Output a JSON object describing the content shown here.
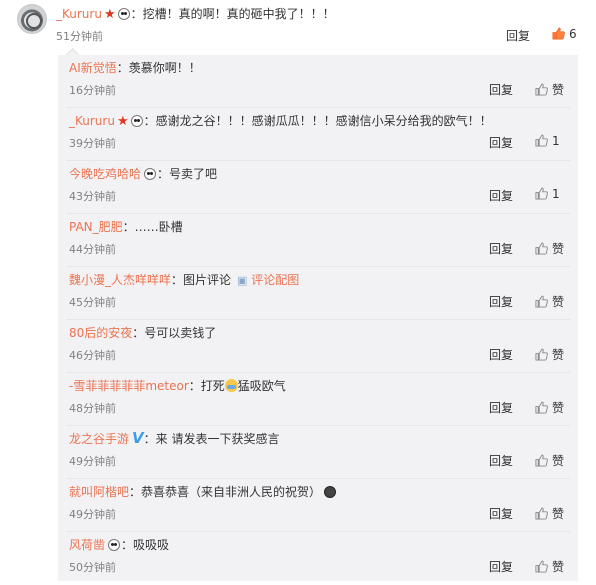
{
  "main_comment": {
    "username": "_Kururu",
    "text": "：挖槽！真的啊！真的砸中我了！！！",
    "time": "51分钟前",
    "reply_label": "回复",
    "like_count": "6"
  },
  "replies": [
    {
      "username": "AI新觉悟",
      "text": "：羡慕你啊！！",
      "time": "16分钟前",
      "reply_label": "回复",
      "like": "赞"
    },
    {
      "username": "_Kururu",
      "text": "：感谢龙之谷！！！感谢瓜瓜！！！感谢信小呆分给我的欧气！！",
      "time": "39分钟前",
      "reply_label": "回复",
      "like": "1"
    },
    {
      "username": "今晚吃鸡哈哈",
      "text": "：号卖了吧",
      "time": "43分钟前",
      "reply_label": "回复",
      "like": "1"
    },
    {
      "username": "PAN_肥肥",
      "text": "：……卧槽",
      "time": "44分钟前",
      "reply_label": "回复",
      "like": "赞"
    },
    {
      "username": "魏小漫_人杰咩咩咩",
      "text": "：图片评论",
      "link": "评论配图",
      "time": "45分钟前",
      "reply_label": "回复",
      "like": "赞"
    },
    {
      "username": "80后的安夜",
      "text": "：号可以卖钱了",
      "time": "46分钟前",
      "reply_label": "回复",
      "like": "赞"
    },
    {
      "username": "-雪菲菲菲菲菲meteor",
      "text_a": "：打死",
      "text_b": "猛吸欧气",
      "time": "48分钟前",
      "reply_label": "回复",
      "like": "赞"
    },
    {
      "username": "龙之谷手游",
      "text": "：来 请发表一下获奖感言",
      "time": "49分钟前",
      "reply_label": "回复",
      "like": "赞"
    },
    {
      "username": "就叫阿楷吧",
      "text": "：恭喜恭喜（来自非洲人民的祝贺）",
      "time": "49分钟前",
      "reply_label": "回复",
      "like": "赞"
    },
    {
      "username": "风荷凿",
      "text": "：吸吸吸",
      "time": "50分钟前",
      "reply_label": "回复",
      "like": "赞"
    }
  ],
  "colors": {
    "username": "#eb7350",
    "verified": "#3d9ee5",
    "reply_bg": "#f2f2f5"
  },
  "icons": [
    "star-badge-icon",
    "panda-emoji-icon",
    "thumbs-up-icon",
    "image-icon",
    "verified-v-icon",
    "crying-emoji-icon",
    "earth-emoji-icon"
  ]
}
